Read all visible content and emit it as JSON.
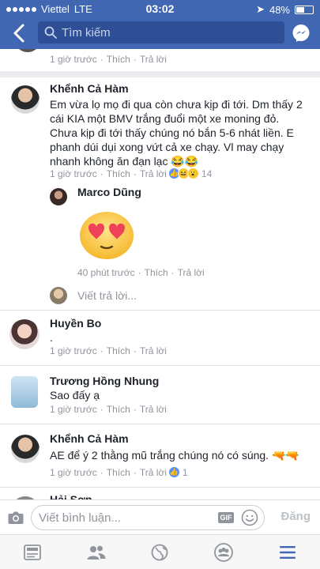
{
  "status_bar": {
    "carrier": "Viettel",
    "network": "LTE",
    "time": "03:02",
    "battery": "48%",
    "battery_level": 0.48
  },
  "header": {
    "search_placeholder": "Tìm kiếm"
  },
  "partial_top_meta": {
    "time": "1 giờ trước",
    "like": "Thích",
    "reply": "Trả lời"
  },
  "comments": [
    {
      "name": "Khểnh Cả Hàm",
      "lines": [
        "Em vừa lọ mọ đi qua còn chưa kịp đi tới. Dm thấy 2",
        "cái KIA một BMV trắng đuổi một xe moning đỏ.",
        "Chưa kịp đi tới thấy chúng nó bắn 5-6 nhát liền. E",
        "phanh dúi dụi xong vứt cả xe chạy. Vl may chạy",
        "nhanh không ăn đạn lạc 😂😂"
      ],
      "time": "1 giờ trước",
      "like": "Thích",
      "reply": "Trả lời",
      "reaction_count": "14",
      "reply_item": {
        "name": "Marco Dũng",
        "time": "40 phút trước",
        "like": "Thích",
        "reply": "Trả lời",
        "sticker": "heart-eyes-emoji"
      },
      "reply_placeholder": "Viết trả lời..."
    },
    {
      "name": "Huyền Bo",
      "text": ".",
      "time": "1 giờ trước",
      "like": "Thích",
      "reply": "Trả lời"
    },
    {
      "name": "Trương Hồng Nhung",
      "text": "Sao đấy ạ",
      "time": "1 giờ trước",
      "like": "Thích",
      "reply": "Trả lời"
    },
    {
      "name": "Khểnh Cả Hàm",
      "text": "AE để ý 2 thằng mũ trắng chúng nó có súng. 🔫🔫",
      "time": "1 giờ trước",
      "like": "Thích",
      "reply": "Trả lời",
      "reaction_count": "1"
    },
    {
      "name": "Hải Sơn"
    }
  ],
  "composer": {
    "placeholder": "Viết bình luận...",
    "gif": "GIF",
    "post": "Đăng"
  },
  "colors": {
    "brand": "#4267b2",
    "meta": "#90949c",
    "like": "#5890ff"
  }
}
